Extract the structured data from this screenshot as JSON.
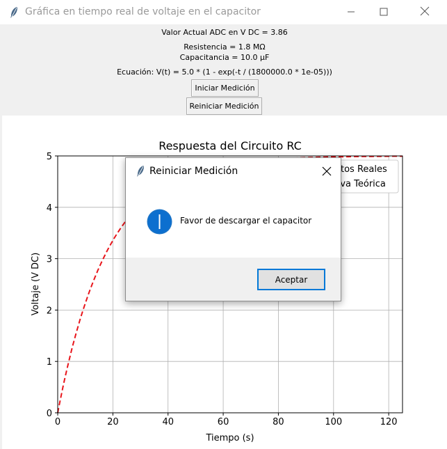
{
  "window": {
    "title": "Gráfica en tiempo real de voltaje en el capacitor",
    "icon": "feather-icon"
  },
  "controls": {
    "adc_value": "Valor Actual ADC en V DC = 3.86",
    "resistance": "Resistencia = 1.8 MΩ",
    "capacitance": "Capacitancia = 10.0 µF",
    "equation": "Ecuación: V(t) = 5.0 * (1 - exp(-t / (1800000.0 * 1e-05)))",
    "start_button": "Iniciar Medición",
    "reset_button": "Reiniciar Medición"
  },
  "chart_data": {
    "type": "line",
    "title": "Respuesta del Circuito RC",
    "xlabel": "Tiempo (s)",
    "ylabel": "Voltaje (V DC)",
    "xlim": [
      0,
      125
    ],
    "ylim": [
      0,
      5
    ],
    "xticks": [
      "0",
      "20",
      "40",
      "60",
      "80",
      "100",
      "120"
    ],
    "yticks": [
      "0",
      "1",
      "2",
      "3",
      "4",
      "5"
    ],
    "grid": true,
    "legend_position": "top-right",
    "legend_visible_text": [
      "tos Reales",
      "rva Teórica"
    ],
    "series": [
      {
        "name": "Curva Teórica",
        "style": "dashed",
        "color": "#e8141a",
        "equation": "5.0 * (1 - exp(-t / 18))",
        "x": [
          0,
          5,
          10,
          15,
          20,
          25,
          30,
          40,
          50,
          60,
          70,
          80,
          90,
          100,
          110,
          120,
          125
        ],
        "y": [
          0,
          1.21,
          2.13,
          2.83,
          3.37,
          3.77,
          4.05,
          4.46,
          4.69,
          4.82,
          4.9,
          4.94,
          4.97,
          4.98,
          4.99,
          4.99,
          5.0
        ]
      }
    ]
  },
  "dialog": {
    "title": "Reiniciar Medición",
    "message": "Favor de descargar el capacitor",
    "ok_button": "Aceptar",
    "icon": "info-icon"
  }
}
